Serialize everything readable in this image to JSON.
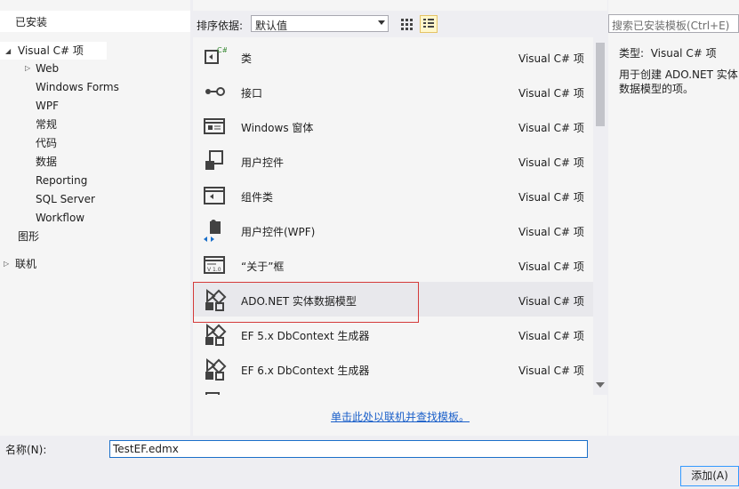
{
  "left_panel": {
    "installed_header": "已安装",
    "tree": [
      {
        "label": "Visual C# 项",
        "selected": true
      },
      {
        "label": "Web"
      },
      {
        "label": "Windows Forms"
      },
      {
        "label": "WPF"
      },
      {
        "label": "常规"
      },
      {
        "label": "代码"
      },
      {
        "label": "数据"
      },
      {
        "label": "Reporting"
      },
      {
        "label": "SQL Server"
      },
      {
        "label": "Workflow"
      },
      {
        "label": "图形"
      }
    ],
    "online": "联机"
  },
  "toolbar": {
    "sort_label": "排序依据:",
    "sort_value": "默认值"
  },
  "templates": [
    {
      "name": "类",
      "type": "Visual C# 项",
      "icon": "class-icon"
    },
    {
      "name": "接口",
      "type": "Visual C# 项",
      "icon": "interface-icon"
    },
    {
      "name": "Windows 窗体",
      "type": "Visual C# 项",
      "icon": "windows-form-icon"
    },
    {
      "name": "用户控件",
      "type": "Visual C# 项",
      "icon": "user-control-icon"
    },
    {
      "name": "组件类",
      "type": "Visual C# 项",
      "icon": "component-class-icon"
    },
    {
      "name": "用户控件(WPF)",
      "type": "Visual C# 项",
      "icon": "wpf-user-control-icon"
    },
    {
      "name": "“关于”框",
      "type": "Visual C# 项",
      "icon": "about-box-icon"
    },
    {
      "name": "ADO.NET 实体数据模型",
      "type": "Visual C# 项",
      "icon": "entity-model-icon",
      "selected": true
    },
    {
      "name": "EF 5.x DbContext 生成器",
      "type": "Visual C# 项",
      "icon": "ef-generator-icon"
    },
    {
      "name": "EF 6.x DbContext 生成器",
      "type": "Visual C# 项",
      "icon": "ef-generator-icon"
    }
  ],
  "online_link": "单击此处以联机并查找模板。",
  "right_panel": {
    "search_placeholder": "搜索已安装模板(Ctrl+E)",
    "type_label": "类型:",
    "type_value": "Visual C# 项",
    "description": "用于创建 ADO.NET 实体数据模型的项。"
  },
  "bottom": {
    "name_label": "名称(N):",
    "name_value": "TestEF.edmx",
    "add_button": "添加(A)"
  },
  "colors": {
    "selection_border": "#d43a3a",
    "link": "#1a5fc9",
    "input_focus": "#1a6fc9",
    "panel_bg": "#f5f5f5"
  }
}
